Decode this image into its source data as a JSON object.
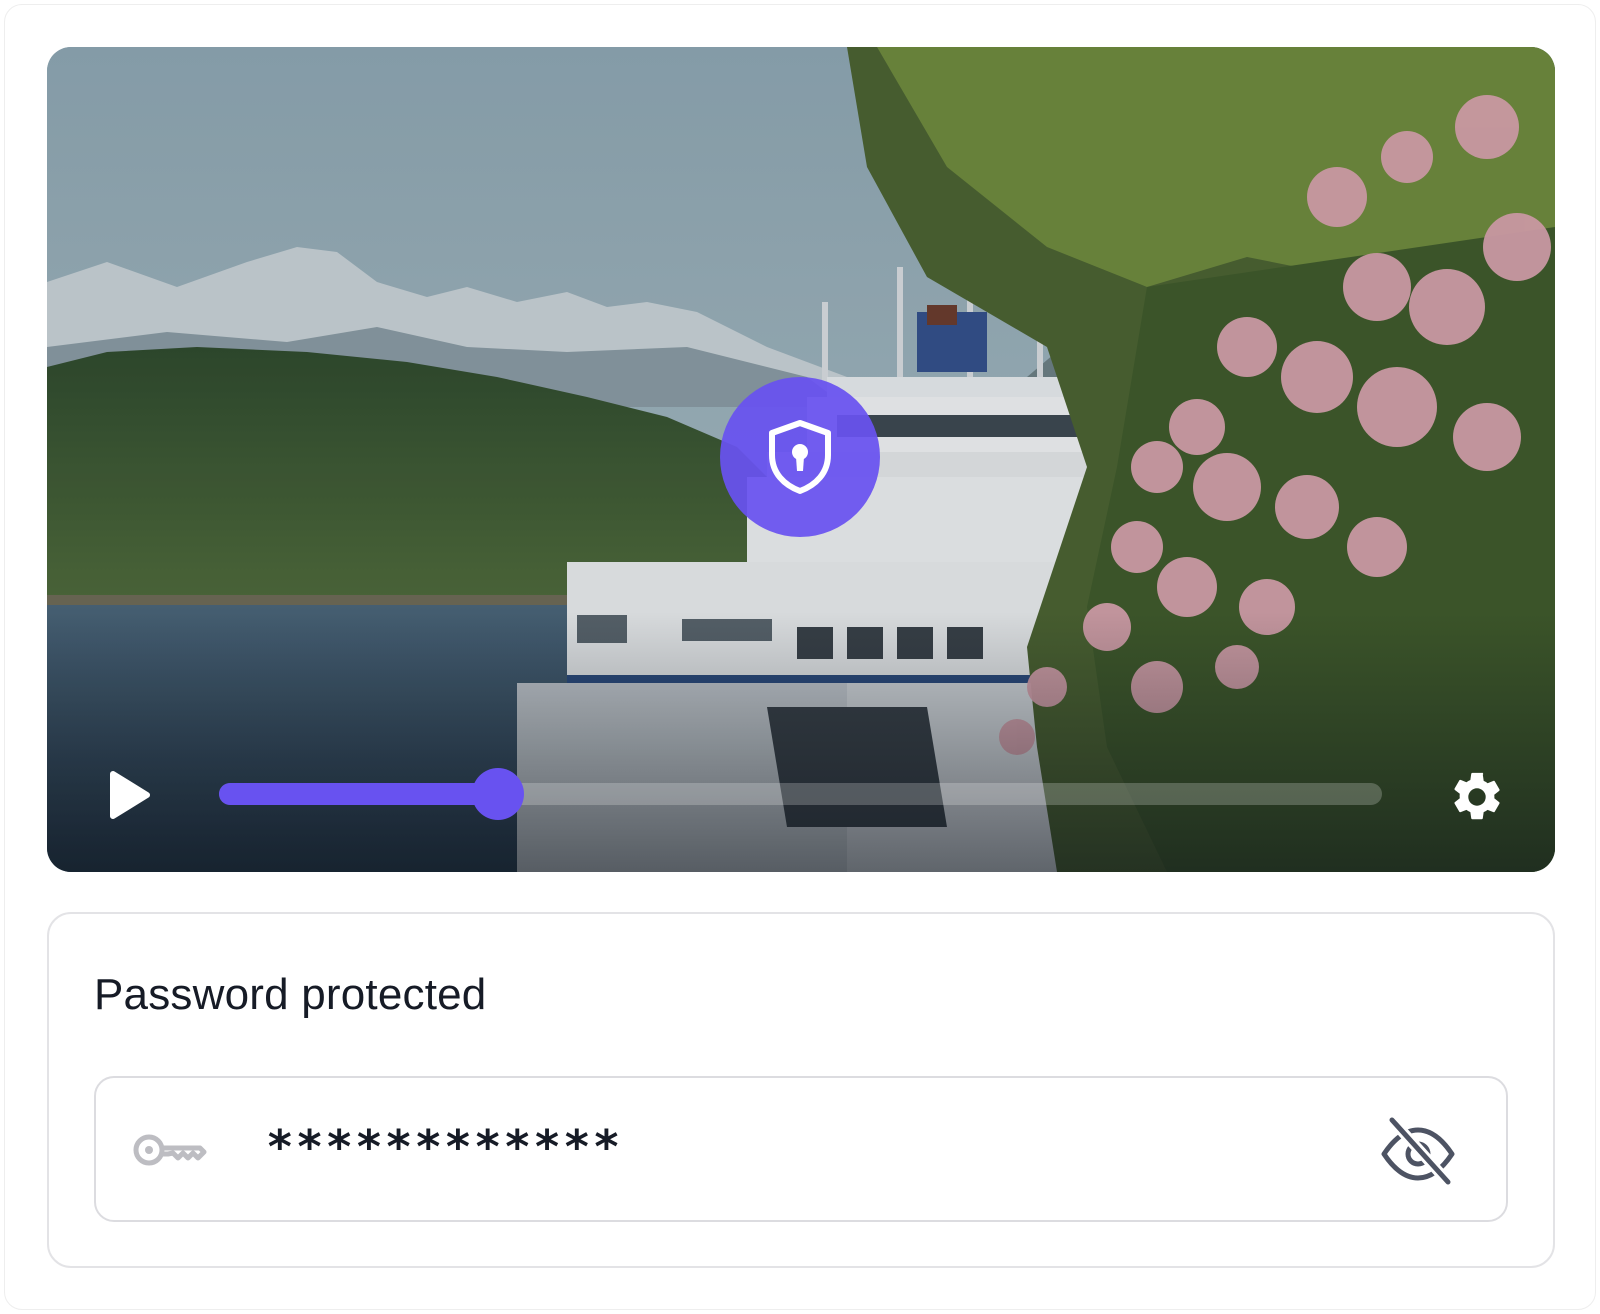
{
  "player": {
    "thumbnail": "ferry-mountains-blossom-scene",
    "lock_icon": "shield-keyhole-icon",
    "play_icon": "play-icon",
    "settings_icon": "gear-icon",
    "progress": 0.24,
    "accent_color": "#6852f0"
  },
  "password_card": {
    "title": "Password protected",
    "key_icon": "key-icon",
    "password_mask": "************",
    "visibility_icon": "eye-off-icon"
  }
}
